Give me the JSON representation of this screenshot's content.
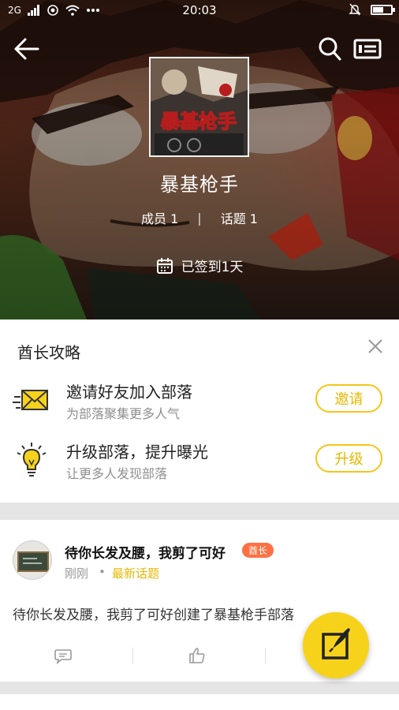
{
  "status_bar": {
    "network": "2G",
    "time": "20:03",
    "battery_level": 0.6
  },
  "header": {
    "tribe_name": "暴基枪手",
    "cover_text": "暴基枪手",
    "stats": {
      "members_label": "成员",
      "members_count": "1",
      "topics_label": "话题",
      "topics_count": "1"
    },
    "checkin_text": "已签到1天"
  },
  "guide": {
    "title": "酋长攻略",
    "items": [
      {
        "title": "邀请好友加入部落",
        "subtitle": "为部落聚集更多人气",
        "button": "邀请",
        "icon": "envelope-icon"
      },
      {
        "title": "升级部落，提升曝光",
        "subtitle": "让更多人发现部落",
        "button": "升级",
        "icon": "lightbulb-icon"
      }
    ]
  },
  "post": {
    "author": "待你长发及腰，我剪了可好",
    "badge": "酋长",
    "time": "刚刚",
    "separator": "•",
    "tag": "最新话题",
    "body": "待你长发及腰，我剪了可好创建了暴基枪手部落"
  },
  "colors": {
    "accent_yellow": "#f7d21b",
    "button_yellow": "#e6b800",
    "badge_orange": "#ff7043"
  }
}
